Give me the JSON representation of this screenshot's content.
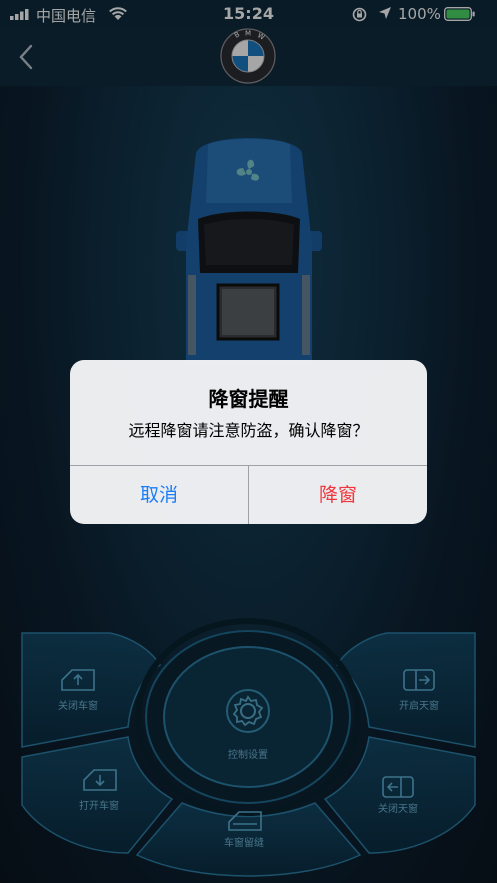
{
  "status_bar": {
    "carrier": "中国电信",
    "time": "15:24",
    "battery_percent": "100%"
  },
  "nav": {
    "back_icon": "chevron-left-icon",
    "logo_text": "BMW"
  },
  "car": {
    "fan_icon": "fan-icon"
  },
  "dialog": {
    "title": "降窗提醒",
    "message": "远程降窗请注意防盗，确认降窗？",
    "cancel_label": "取消",
    "confirm_label": "降窗",
    "cancel_color": "#1a7ef7",
    "confirm_color": "#f0373d"
  },
  "controls": {
    "close_window": "关闭车窗",
    "open_sunroof": "开启天窗",
    "settings": "控制设置",
    "open_window": "打开车窗",
    "close_sunroof": "关闭天窗",
    "window_gap": "车窗留缝"
  }
}
